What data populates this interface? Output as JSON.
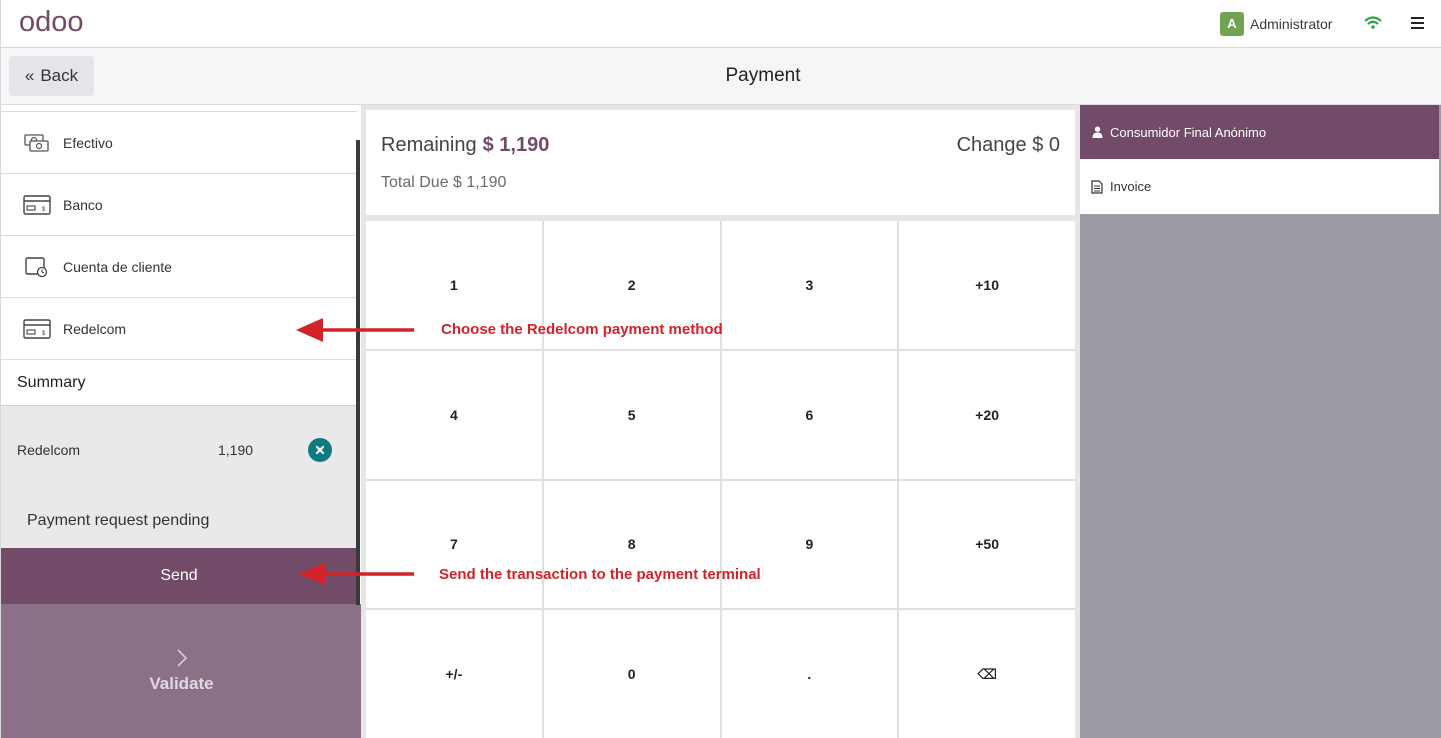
{
  "app": {
    "logo_text": "odoo",
    "user_initial": "A",
    "user_name": "Administrator"
  },
  "header": {
    "back_label": "Back",
    "title": "Payment"
  },
  "payment_methods": [
    {
      "label": "Efectivo",
      "icon": "cash-icon"
    },
    {
      "label": "Banco",
      "icon": "card-icon"
    },
    {
      "label": "Cuenta de cliente",
      "icon": "customer-account-icon"
    },
    {
      "label": "Redelcom",
      "icon": "card-icon"
    }
  ],
  "summary": {
    "heading": "Summary",
    "line": {
      "method": "Redelcom",
      "amount": "1,190"
    },
    "pending_text": "Payment request pending",
    "send_label": "Send"
  },
  "validate": {
    "label": "Validate"
  },
  "status": {
    "remaining_label": "Remaining",
    "remaining_value": "$ 1,190",
    "change_label": "Change",
    "change_value": "$ 0",
    "total_due_label": "Total Due",
    "total_due_value": "$ 1,190"
  },
  "numpad": [
    "1",
    "2",
    "3",
    "+10",
    "4",
    "5",
    "6",
    "+20",
    "7",
    "8",
    "9",
    "+50",
    "+/-",
    "0",
    ".",
    "⌫"
  ],
  "right": {
    "customer_label": "Consumidor Final Anónimo",
    "invoice_label": "Invoice"
  },
  "annotations": {
    "choose_method": "Choose the Redelcom payment method",
    "send_transaction": "Send the transaction to the payment terminal"
  },
  "colors": {
    "brand": "#714b67",
    "annotation": "#d2232a",
    "delete": "#0f7a7f",
    "avatar": "#71a352"
  }
}
